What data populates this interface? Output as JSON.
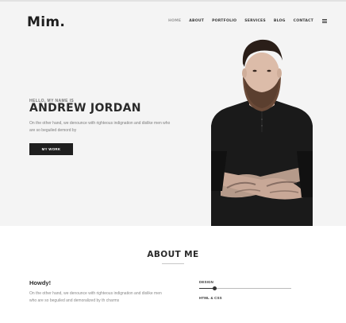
{
  "brand": {
    "logo": "Mim."
  },
  "nav": {
    "items": [
      {
        "label": "HOME",
        "active": true
      },
      {
        "label": "ABOUT",
        "active": false
      },
      {
        "label": "PORTFOLIO",
        "active": false
      },
      {
        "label": "SERVICES",
        "active": false
      },
      {
        "label": "BLOG",
        "active": false
      },
      {
        "label": "CONTACT",
        "active": false
      }
    ],
    "menu_icon": "hamburger-menu-icon"
  },
  "hero": {
    "greeting": "HELLO, MY NAME IS",
    "name": "ANDREW JORDAN",
    "intro": "On the other hand, we denounce with righteous indignation and dislike men who are so beguiled demord by",
    "button": "MY WORK"
  },
  "about": {
    "title": "ABOUT ME",
    "heading": "Howdy!",
    "text": "On the other hand, we denounce with righteous indignation and dislike men who are so beguiled and demoralized by th charms",
    "skills": [
      {
        "label": "DESIGN",
        "percent": 17
      },
      {
        "label": "HTML & CSS",
        "percent": null
      }
    ]
  },
  "colors": {
    "hero_bg": "#f4f4f4",
    "button_bg": "#1f1f1f",
    "text_dark": "#2a2a2a"
  }
}
